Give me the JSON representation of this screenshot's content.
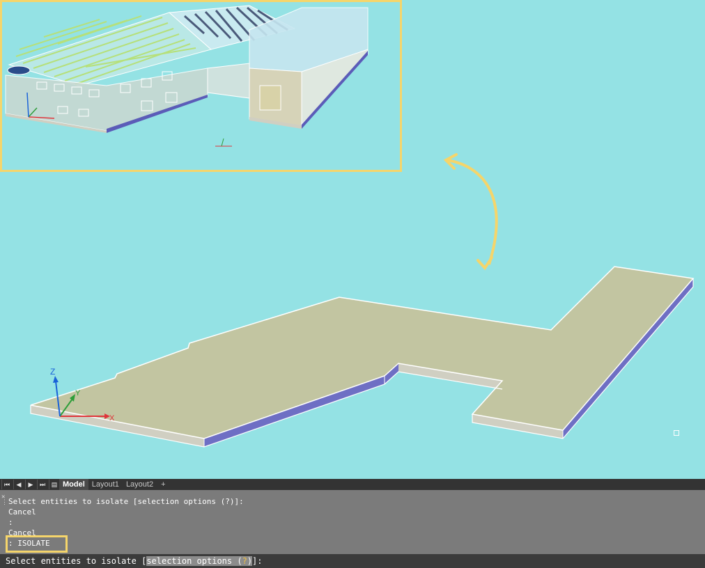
{
  "layout_tabs": {
    "nav_first": "⏮",
    "nav_prev": "◀",
    "nav_next": "▶",
    "nav_last": "⏭",
    "nav_menu": "▤",
    "tabs": [
      {
        "label": "Model",
        "active": true
      },
      {
        "label": "Layout1",
        "active": false
      },
      {
        "label": "Layout2",
        "active": false
      }
    ],
    "add_tab": "+"
  },
  "command_history": [
    "Select entities to isolate [selection options (?)]:",
    "Cancel",
    ":",
    "Cancel",
    ": ISOLATE"
  ],
  "command_line": {
    "before": "Select entities to isolate [",
    "option": "selection options (",
    "hotkey": "?",
    "option_close": ")",
    "after": "]:"
  },
  "ucs": {
    "x_label": "X",
    "y_label": "Y",
    "z_label": "Z"
  },
  "colors": {
    "viewport_bg": "#94e2e4",
    "highlight": "#f5d56b",
    "slab_top": "#c2c5a1",
    "slab_front": "#d0cfc2",
    "slab_side": "#6e6fc4",
    "axis_x": "#e0343a",
    "axis_y": "#2e9e3a",
    "axis_z": "#1a62d8"
  }
}
